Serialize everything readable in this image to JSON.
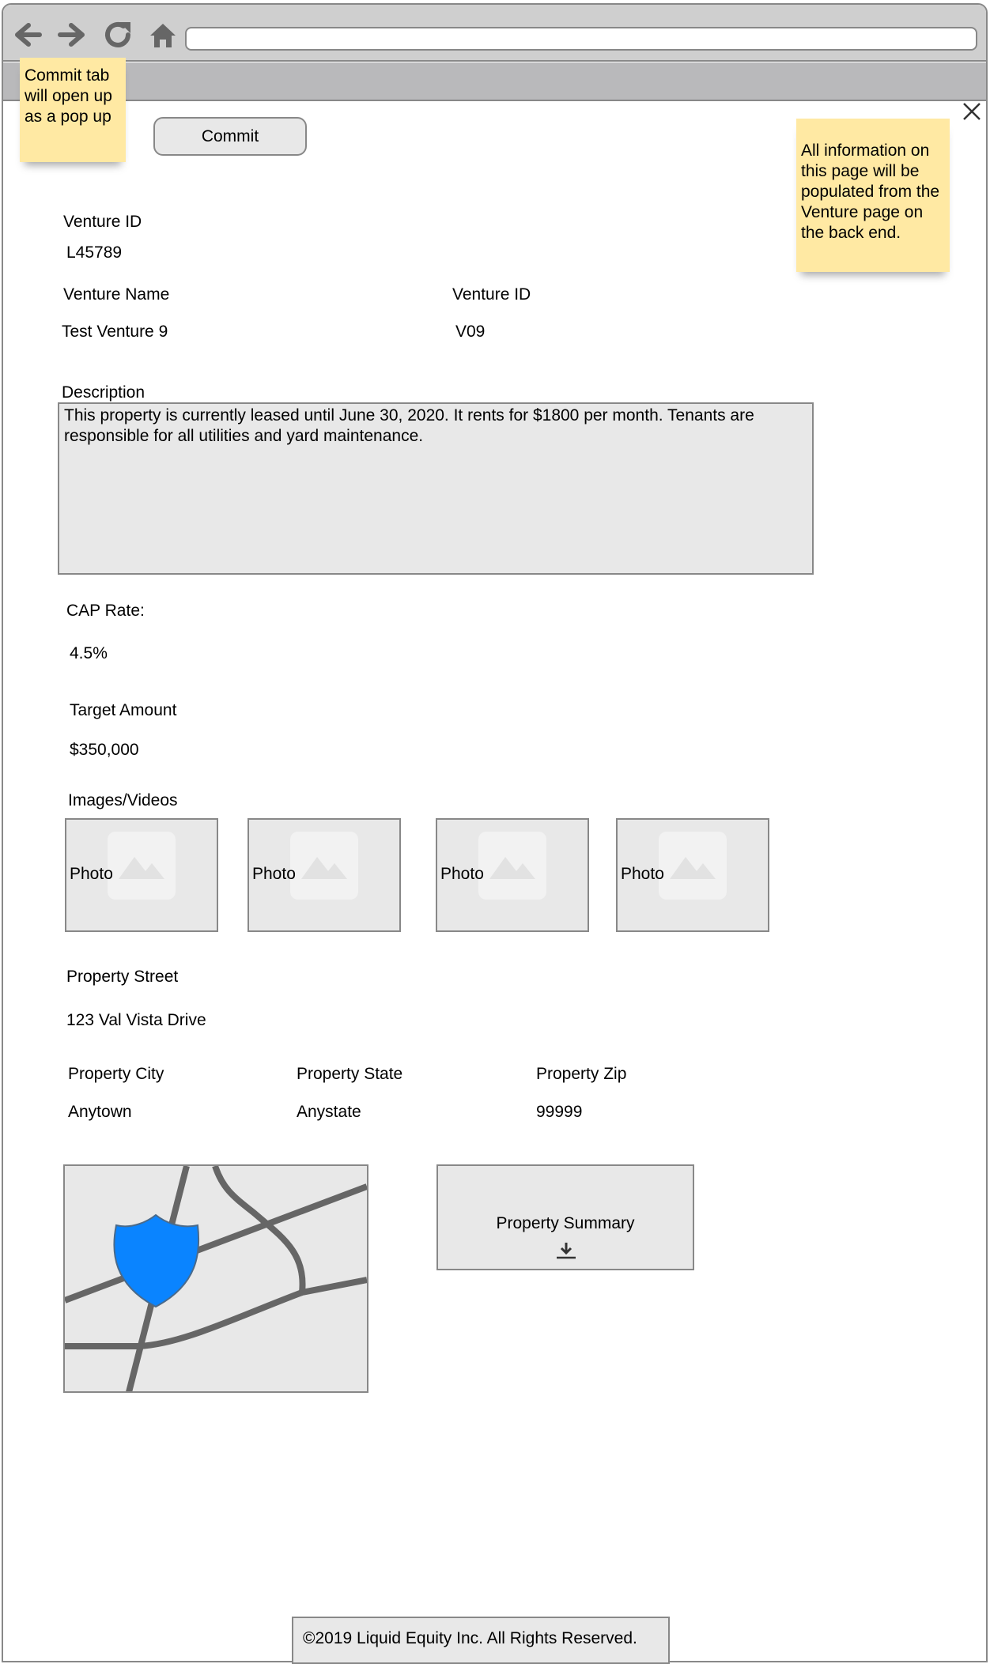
{
  "browser": {
    "back_icon": "arrow-left-icon",
    "forward_icon": "arrow-right-icon",
    "reload_icon": "reload-icon",
    "home_icon": "home-icon",
    "url": ""
  },
  "notes": {
    "commit_note": "Commit tab will open up as a pop up",
    "info_note": "All information on this page will be populated from the Venture page on the back end."
  },
  "toolbar": {
    "commit_label": "Commit",
    "close_icon": "close-icon"
  },
  "venture": {
    "id_label": "Venture ID",
    "id_value": "L45789",
    "name_label": "Venture Name",
    "name_value": "Test Venture 9",
    "id2_label": "Venture ID",
    "id2_value": "V09"
  },
  "description": {
    "label": "Description",
    "text": "This property is currently leased until June 30, 2020. It rents for $1800 per month. Tenants are responsible for all utilities and yard maintenance."
  },
  "financials": {
    "cap_rate_label": "CAP Rate:",
    "cap_rate_value": "4.5%",
    "target_label": "Target Amount",
    "target_value": "$350,000"
  },
  "media": {
    "label": "Images/Videos",
    "photos": [
      "Photo",
      "Photo",
      "Photo",
      "Photo"
    ]
  },
  "address": {
    "street_label": "Property Street",
    "street_value": "123 Val Vista Drive",
    "city_label": "Property City",
    "city_value": "Anytown",
    "state_label": "Property State",
    "state_value": "Anystate",
    "zip_label": "Property Zip",
    "zip_value": "99999"
  },
  "summary": {
    "label": "Property Summary",
    "icon": "download-icon"
  },
  "map": {
    "icon": "map-icon",
    "marker_color": "#0a84ff"
  },
  "footer": {
    "text": "©2019 Liquid Equity Inc. All Rights Reserved."
  }
}
